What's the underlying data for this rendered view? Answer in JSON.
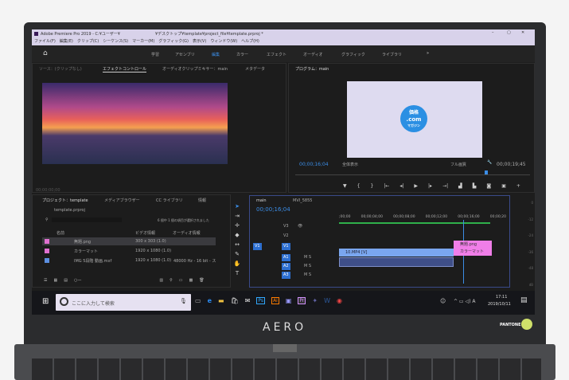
{
  "window": {
    "title": "Adobe Premiere Pro 2019 - C:¥ユーザー¥",
    "path": "¥デスクトップ¥template¥project_file¥template.prproj *"
  },
  "menu": [
    "ファイル(F)",
    "編集(E)",
    "クリップ(C)",
    "シーケンス(S)",
    "マーカー(M)",
    "グラフィック(G)",
    "表示(V)",
    "ウィンドウ(W)",
    "ヘルプ(H)"
  ],
  "workspaces": [
    "学習",
    "アセンブリ",
    "編集",
    "カラー",
    "エフェクト",
    "オーディオ",
    "グラフィック",
    "ライブラリ"
  ],
  "workspace_active": "編集",
  "source_tabs": [
    "ソース：(クリップなし)",
    "エフェクトコントロール",
    "オーディオクリップミキサー：main",
    "メタデータ"
  ],
  "source_timecode": "00;00;00;00",
  "program": {
    "tab": "プログラム：main",
    "timecode": "00;00;16;04",
    "zoom": "全体表示",
    "quality": "フル画質",
    "duration": "00;00;19;45",
    "logo": [
      "価格",
      ".com",
      "マガジン"
    ]
  },
  "project": {
    "tabs": [
      "プロジェクト：template",
      "メディアブラウザー",
      "CC ライブラリ",
      "情報"
    ],
    "file": "template.prproj",
    "status": "6 個中 1 個の項目が選択されました",
    "columns": [
      "名前",
      "ビデオ情報",
      "オーディオ情報"
    ],
    "rows": [
      {
        "name": "無題.png",
        "video": "300 x 303 (1.0)",
        "audio": "",
        "color": "#e070d0"
      },
      {
        "name": "カラーマット",
        "video": "1920 x 1080 (1.0)",
        "audio": "",
        "color": "#e070d0"
      },
      {
        "name": "IMG 5段階 動画.mxf",
        "video": "1920 x 1080 (1.0)",
        "audio": "48000 Hz - 16 bit - ス",
        "color": "#5c8fe0"
      }
    ]
  },
  "timeline": {
    "tabs": [
      "main",
      "MVI_5855"
    ],
    "timecode": "00;00;16;04",
    "ruler": [
      ";00;00",
      "00;00;04;00",
      "00;00;08;00",
      "00;00;12;00",
      "00;00;16;00",
      "00;00;20"
    ],
    "video_tracks": [
      "V3",
      "V2",
      "V1"
    ],
    "audio_tracks": [
      "A1",
      "A2",
      "A3"
    ],
    "source_patch": "V1",
    "clips": {
      "video": "10.MP4 [V]",
      "png": "無題.png",
      "matte": "カラーマット"
    }
  },
  "meters": [
    "0",
    "-12",
    "-24",
    "-36",
    "-48",
    "dB"
  ],
  "taskbar": {
    "search_placeholder": "ここに入力して検索",
    "time": "17:11",
    "date": "2019/10/11"
  },
  "brand": {
    "logo": "AERO",
    "pantone": "PANTONE"
  }
}
